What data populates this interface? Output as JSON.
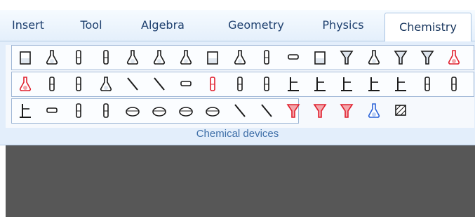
{
  "tabs": [
    {
      "label": "Insert"
    },
    {
      "label": "Tool"
    },
    {
      "label": "Algebra"
    },
    {
      "label": "Geometry"
    },
    {
      "label": "Physics"
    },
    {
      "label": "Chemistry",
      "active": true
    }
  ],
  "ribbon": {
    "group_label": "Chemical devices",
    "rows": [
      {
        "icons": [
          "beaker-icon",
          "flask-icon",
          "test-tube-icon",
          "test-tube-clamp-icon",
          "round-flask-icon",
          "conical-flask-icon",
          "conical-flask-stopper-icon",
          "gas-jar-icon",
          "burette-bulb-icon",
          "graduated-cylinder-icon",
          "bell-jar-icon",
          "trough-icon",
          "funnel-icon",
          "dropping-funnel-icon",
          "separating-funnel-icon",
          "thistle-funnel-icon",
          "red-pipette-icon"
        ]
      },
      {
        "icons": [
          "red-bulb-pipette-icon",
          "chimney-icon",
          "filter-column-icon",
          "dropper-icon",
          "glass-rod-icon",
          "spatula-icon",
          "connector-icon",
          "red-tube-icon",
          "bent-tube-icon",
          "u-tube-icon",
          "stand-icon",
          "support-stand-icon",
          "furnace-icon",
          "balance-icon",
          "retort-stand-icon",
          "condenser-icon",
          "thermometer-icon"
        ]
      },
      {
        "icons": [
          "clamp-icon",
          "stopper-icon",
          "hook-tube-icon",
          "curved-tube-icon",
          "evaporating-dish-icon",
          "crucible-icon",
          "watch-glass-icon",
          "wire-gauze-icon",
          "tongs-icon",
          "stirring-rod-icon",
          "red-flame-icon",
          "red-burner-icon",
          "red-spark-icon",
          "blue-water-drop-icon",
          "hatched-square-icon"
        ]
      }
    ]
  },
  "colors": {
    "accent": "#3f6fa8",
    "tab_text": "#1d3f6e",
    "workspace": "#575757",
    "ribbon": "#e3eefb"
  }
}
